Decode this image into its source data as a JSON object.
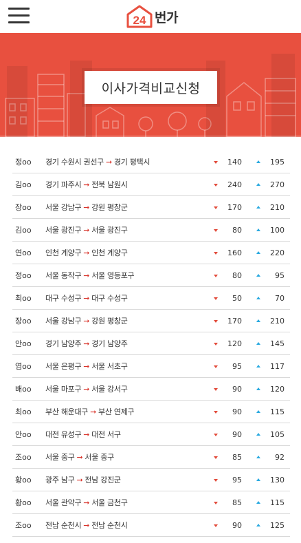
{
  "header": {
    "logo_number": "24",
    "logo_text": "번가"
  },
  "hero": {
    "title": "이사가격비교신청"
  },
  "colors": {
    "brand_red": "#e8503f",
    "decrease": "#e24a3a",
    "increase": "#29a9e0",
    "route_arrow": "#d9342b"
  },
  "icons": {
    "menu": "hamburger-menu-icon",
    "logo": "house-24-logo-icon",
    "min": "triangle-down-icon",
    "max": "triangle-up-icon",
    "route": "right-arrow-icon"
  },
  "route_arrow": "➞",
  "requests": [
    {
      "name": "정oo",
      "from": "경기 수원시 권선구",
      "to": "경기 평택시",
      "min": "140",
      "max": "195"
    },
    {
      "name": "김oo",
      "from": "경기 파주시",
      "to": "전북 남원시",
      "min": "240",
      "max": "270"
    },
    {
      "name": "장oo",
      "from": "서울 강남구",
      "to": "강원 평창군",
      "min": "170",
      "max": "210"
    },
    {
      "name": "김oo",
      "from": "서울 광진구",
      "to": "서울 광진구",
      "min": "80",
      "max": "100"
    },
    {
      "name": "연oo",
      "from": "인천 계양구",
      "to": "인천 계양구",
      "min": "160",
      "max": "220"
    },
    {
      "name": "정oo",
      "from": "서울 동작구",
      "to": "서울 영등포구",
      "min": "80",
      "max": "95"
    },
    {
      "name": "최oo",
      "from": "대구 수성구",
      "to": "대구 수성구",
      "min": "50",
      "max": "70"
    },
    {
      "name": "장oo",
      "from": "서울 강남구",
      "to": "강원 평창군",
      "min": "170",
      "max": "210"
    },
    {
      "name": "안oo",
      "from": "경기 남양주",
      "to": "경기 남양주",
      "min": "120",
      "max": "145"
    },
    {
      "name": "염oo",
      "from": "서울 은평구",
      "to": "서울 서초구",
      "min": "95",
      "max": "117"
    },
    {
      "name": "배oo",
      "from": "서울 마포구",
      "to": "서울 강서구",
      "min": "90",
      "max": "120"
    },
    {
      "name": "최oo",
      "from": "부산 해운대구",
      "to": "부산 연제구",
      "min": "90",
      "max": "115"
    },
    {
      "name": "안oo",
      "from": "대전 유성구",
      "to": "대전 서구",
      "min": "90",
      "max": "105"
    },
    {
      "name": "조oo",
      "from": "서울 중구",
      "to": "서울 중구",
      "min": "85",
      "max": "92"
    },
    {
      "name": "황oo",
      "from": "광주 남구",
      "to": "전남 강진군",
      "min": "95",
      "max": "130"
    },
    {
      "name": "황oo",
      "from": "서울 관악구",
      "to": "서울 금천구",
      "min": "85",
      "max": "115"
    },
    {
      "name": "조oo",
      "from": "전남 순천시",
      "to": "전남 순천시",
      "min": "90",
      "max": "125"
    }
  ]
}
